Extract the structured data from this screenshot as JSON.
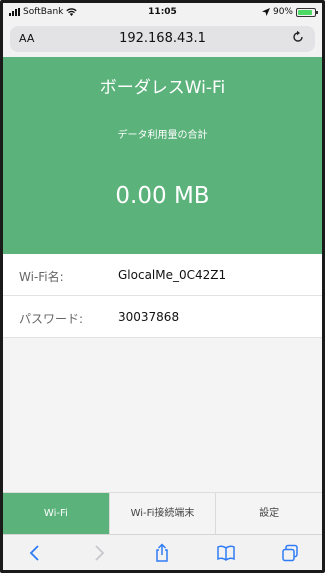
{
  "status_bar": {
    "carrier": "SoftBank",
    "time": "11:05",
    "battery": "90%",
    "battery_level": 0.9
  },
  "browser": {
    "aa_label": "AA",
    "url": "192.168.43.1"
  },
  "header": {
    "title": "ボーダレスWi-Fi",
    "usage_label": "データ利用量の合計",
    "usage_value": "0.00 MB"
  },
  "info": {
    "ssid_label": "Wi-Fi名:",
    "ssid_value": "GlocalMe_0C42Z1",
    "password_label": "パスワード:",
    "password_value": "30037868"
  },
  "tabs": [
    {
      "label": "Wi-Fi",
      "active": true
    },
    {
      "label": "Wi-Fi接続端末",
      "active": false
    },
    {
      "label": "設定",
      "active": false
    }
  ],
  "colors": {
    "accent": "#5cb27b"
  }
}
